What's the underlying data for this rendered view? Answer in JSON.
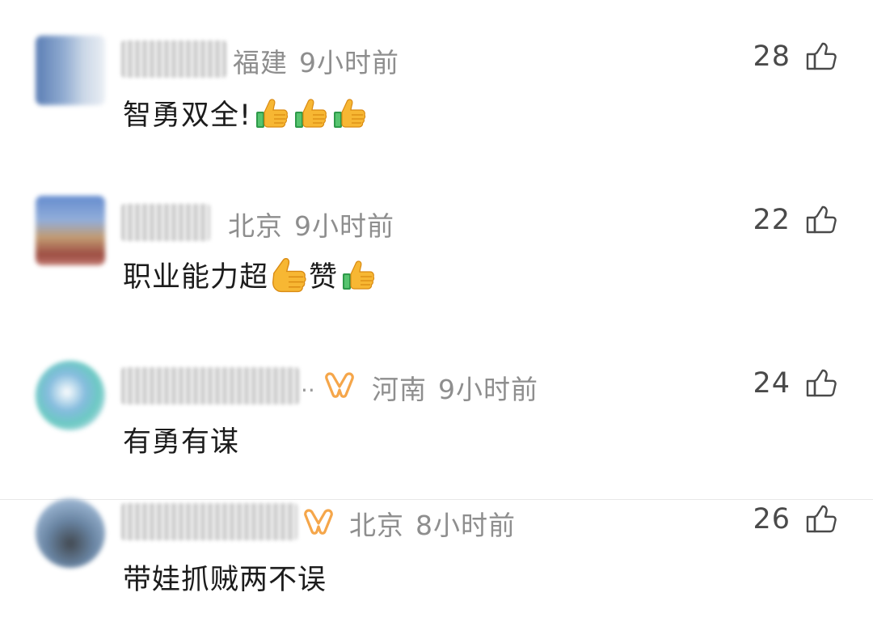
{
  "comments": [
    {
      "location": "福建",
      "time": "9小时前",
      "text": "智勇双全!",
      "likes": "28"
    },
    {
      "location": "北京",
      "time": "9小时前",
      "text_a": "职业能力超",
      "text_b": "赞",
      "likes": "22"
    },
    {
      "location": "河南",
      "time": "9小时前",
      "text": "有勇有谋",
      "likes": "24",
      "nick_ellipsis": ".."
    },
    {
      "location": "北京",
      "time": "8小时前",
      "text": "带娃抓贼两不误",
      "likes": "26"
    }
  ],
  "icons": {
    "like": "thumb-up-outline-icon",
    "emoji": "thumbs-up-emoji",
    "badge": "orange-ribbon-badge-icon"
  },
  "colors": {
    "meta_text": "#8e8e8e",
    "content_text": "#1c1c1c",
    "like_text": "#4a4a4a",
    "badge": "#f5a64a"
  }
}
